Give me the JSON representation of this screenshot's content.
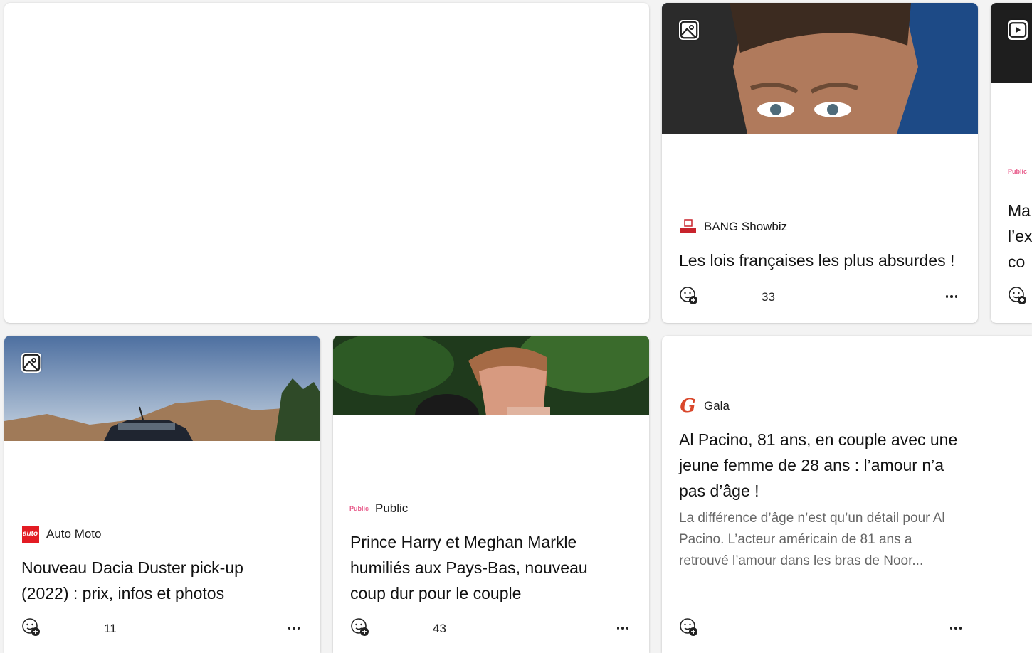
{
  "cards": {
    "bang": {
      "source": "BANG Showbiz",
      "title": "Les lois françaises les plus absurdes !",
      "reactions": "33"
    },
    "partial": {
      "source": "Public",
      "title_lines": [
        "Ma",
        "l’ex",
        "co"
      ]
    },
    "dacia": {
      "source": "Auto Moto",
      "title": "Nouveau Dacia Duster pick-up (2022) : prix, infos et photos",
      "reactions": "11"
    },
    "harry": {
      "source": "Public",
      "title": "Prince Harry et Meghan Markle humiliés aux Pays-Bas, nouveau coup dur pour le couple",
      "reactions": "43"
    },
    "pacino": {
      "source": "Gala",
      "title": "Al Pacino, 81 ans, en couple avec une jeune femme de 28 ans : l’amour n’a pas d’âge !",
      "summary": "La différence d’âge n’est qu’un détail pour Al Pacino. L’acteur américain de 81 ans a retrouvé l’amour dans les bras de Noor..."
    }
  },
  "logos": {
    "public": "Public",
    "auto": "auto",
    "gala": "G"
  },
  "icons": [
    "image-gallery-icon",
    "video-play-icon",
    "add-reaction-icon",
    "more-options-icon"
  ],
  "colors": {
    "public_pink": "#e85a8a",
    "gala_red": "#d9472b",
    "auto_red": "#e31b23"
  }
}
